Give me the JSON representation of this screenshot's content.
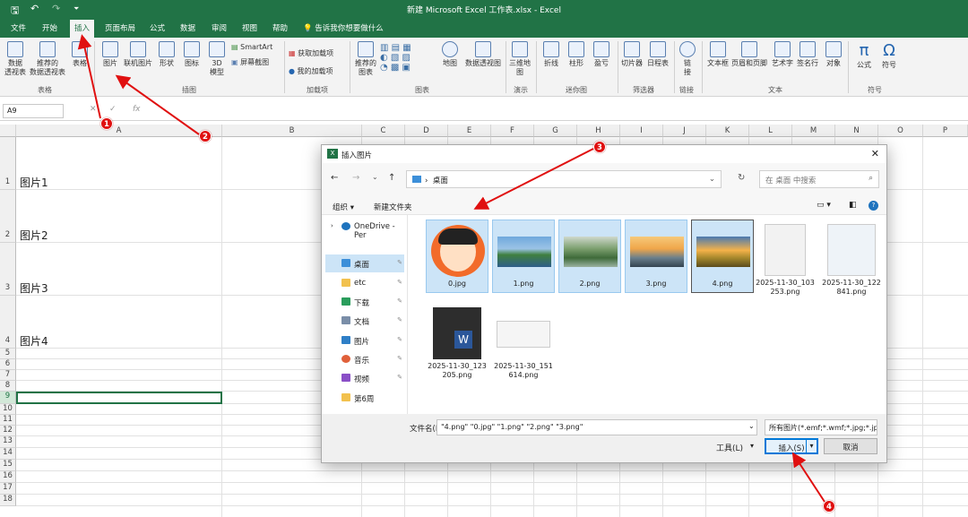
{
  "window": {
    "title": "新建 Microsoft Excel 工作表.xlsx  -  Excel"
  },
  "menu": {
    "tabs": [
      "文件",
      "开始",
      "插入",
      "页面布局",
      "公式",
      "数据",
      "审阅",
      "视图",
      "帮助"
    ],
    "tell_me": "告诉我你想要做什么"
  },
  "ribbon": {
    "table": {
      "pivot": "数据\n透视表",
      "recommended": "推荐的\n数据透视表",
      "table": "表格",
      "group": "表格"
    },
    "illustrations": {
      "picture": "图片",
      "online": "联机图片",
      "shapes": "形状",
      "icons": "图标",
      "model3d": "3D\n模型",
      "smartart": "SmartArt",
      "screenshot": "屏幕截图",
      "group": "插图"
    },
    "addins": {
      "get": "获取加载项",
      "mine": "我的加载项",
      "group": "加载项"
    },
    "charts": {
      "recommended": "推荐的\n图表",
      "maps": "地图",
      "pivotchart": "数据透视图",
      "group": "图表"
    },
    "tours": {
      "map3d": "三维地\n图",
      "group": "演示"
    },
    "sparklines": {
      "line": "折线",
      "column": "柱形",
      "winloss": "盈亏",
      "group": "迷你图"
    },
    "filters": {
      "slicer": "切片器",
      "timeline": "日程表",
      "group": "筛选器"
    },
    "links": {
      "link": "链\n接",
      "group": "链接"
    },
    "text": {
      "textbox": "文本框",
      "headerfooter": "页眉和页脚",
      "wordart": "艺术字",
      "signature": "签名行",
      "object": "对象",
      "group": "文本"
    },
    "symbols": {
      "equation": "公式",
      "symbol": "符号",
      "group": "符号"
    }
  },
  "formula_bar": {
    "name_box": "A9",
    "fx": "fx"
  },
  "sheet": {
    "columns": [
      "A",
      "B",
      "C",
      "D",
      "E",
      "F",
      "G",
      "H",
      "I",
      "J",
      "K",
      "L",
      "M",
      "N",
      "O",
      "P"
    ],
    "rows": [
      "1",
      "2",
      "3",
      "4",
      "5",
      "6",
      "7",
      "8",
      "9",
      "10",
      "11",
      "12",
      "13",
      "14",
      "15",
      "16",
      "17",
      "18"
    ],
    "cells": [
      "图片1",
      "图片2",
      "图片3",
      "图片4"
    ]
  },
  "dialog": {
    "title": "插入图片",
    "address": "桌面",
    "search_placeholder": "在 桌面 中搜索",
    "organize": "组织 ▾",
    "new_folder": "新建文件夹",
    "sidebar": [
      "OneDrive - Per",
      "桌面",
      "etc",
      "下载",
      "文档",
      "图片",
      "音乐",
      "视频",
      "第6周"
    ],
    "files": [
      "0.jpg",
      "1.png",
      "2.png",
      "3.png",
      "4.png",
      "2025-11-30_103\n253.png",
      "2025-11-30_122\n841.png",
      "2025-11-30_123\n205.png",
      "2025-11-30_151\n614.png"
    ],
    "filename_label": "文件名(N):",
    "filename_value": "\"4.png\" \"0.jpg\" \"1.png\" \"2.png\" \"3.png\"",
    "filetype": "所有图片(*.emf;*.wmf;*.jpg;*.jp",
    "tools": "工具(L)",
    "insert": "插入(S)",
    "cancel": "取消"
  },
  "annotations": [
    "1",
    "2",
    "3",
    "4"
  ]
}
